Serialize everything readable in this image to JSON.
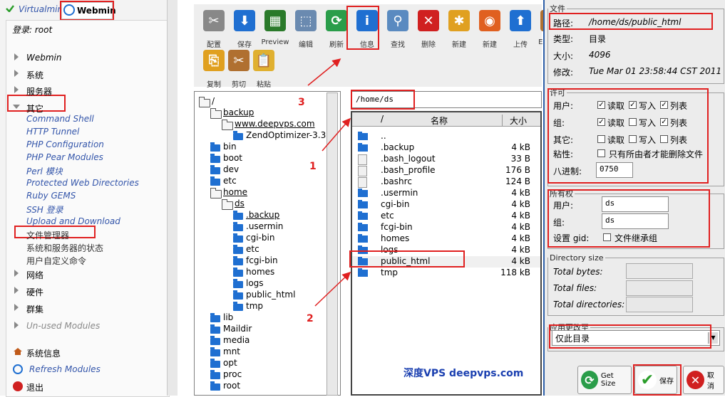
{
  "left": {
    "brand_virtualmin": "Virtualmin",
    "brand_webmin": "Webmin",
    "login_text": "登录: root",
    "nav": [
      {
        "label": "Webmin"
      },
      {
        "label": "系统"
      },
      {
        "label": "服务器"
      },
      {
        "label": "其它"
      }
    ],
    "other_items": [
      {
        "label": "Command Shell"
      },
      {
        "label": "HTTP Tunnel"
      },
      {
        "label": "PHP Configuration"
      },
      {
        "label": "PHP Pear Modules"
      },
      {
        "label": "Perl 模块"
      },
      {
        "label": "Protected Web Directories"
      },
      {
        "label": "Ruby GEMS"
      },
      {
        "label": "SSH 登录"
      },
      {
        "label": "Upload and Download"
      },
      {
        "label": "文件管理器"
      },
      {
        "label": "系统和服务器的状态"
      },
      {
        "label": "用户自定义命令"
      }
    ],
    "nav2": [
      {
        "label": "网络"
      },
      {
        "label": "硬件"
      },
      {
        "label": "群集"
      },
      {
        "label": "Un-used Modules"
      }
    ],
    "footer": [
      {
        "label": "系统信息"
      },
      {
        "label": "Refresh Modules"
      },
      {
        "label": "退出"
      }
    ]
  },
  "toolbar": {
    "row1": [
      {
        "label": "配置",
        "icon": "wrench-icon"
      },
      {
        "label": "保存",
        "icon": "download-arrow-icon"
      },
      {
        "label": "Preview",
        "icon": "preview-icon"
      },
      {
        "label": "编辑",
        "icon": "edit-frame-icon"
      },
      {
        "label": "刷新",
        "icon": "refresh-icon"
      },
      {
        "label": "信息",
        "icon": "info-icon"
      },
      {
        "label": "查找",
        "icon": "magnifier-icon"
      },
      {
        "label": "删除",
        "icon": "delete-icon"
      },
      {
        "label": "新建",
        "icon": "new-file-icon"
      },
      {
        "label": "新建",
        "icon": "firefox-icon"
      },
      {
        "label": "上传",
        "icon": "upload-arrow-icon"
      },
      {
        "label": "Extract",
        "icon": "box-icon"
      }
    ],
    "row2": [
      {
        "label": "复制",
        "icon": "copy-icon"
      },
      {
        "label": "剪切",
        "icon": "scissors-icon"
      },
      {
        "label": "粘贴",
        "icon": "paste-icon"
      }
    ]
  },
  "tree": [
    {
      "label": "/",
      "depth": 0,
      "open": true
    },
    {
      "label": "backup",
      "depth": 1,
      "open": true
    },
    {
      "label": "www.deepvps.com",
      "depth": 2,
      "open": true
    },
    {
      "label": "ZendOptimizer-3.3.",
      "depth": 3,
      "open": false
    },
    {
      "label": "bin",
      "depth": 1,
      "open": false
    },
    {
      "label": "boot",
      "depth": 1,
      "open": false
    },
    {
      "label": "dev",
      "depth": 1,
      "open": false
    },
    {
      "label": "etc",
      "depth": 1,
      "open": false
    },
    {
      "label": "home",
      "depth": 1,
      "open": true
    },
    {
      "label": "ds",
      "depth": 2,
      "open": true
    },
    {
      "label": ".backup",
      "depth": 3,
      "open": false
    },
    {
      "label": ".usermin",
      "depth": 3,
      "open": false
    },
    {
      "label": "cgi-bin",
      "depth": 3,
      "open": false
    },
    {
      "label": "etc",
      "depth": 3,
      "open": false
    },
    {
      "label": "fcgi-bin",
      "depth": 3,
      "open": false
    },
    {
      "label": "homes",
      "depth": 3,
      "open": false
    },
    {
      "label": "logs",
      "depth": 3,
      "open": false
    },
    {
      "label": "public_html",
      "depth": 3,
      "open": false
    },
    {
      "label": "tmp",
      "depth": 3,
      "open": false
    },
    {
      "label": "lib",
      "depth": 1,
      "open": false
    },
    {
      "label": "Maildir",
      "depth": 1,
      "open": false
    },
    {
      "label": "media",
      "depth": 1,
      "open": false
    },
    {
      "label": "mnt",
      "depth": 1,
      "open": false
    },
    {
      "label": "opt",
      "depth": 1,
      "open": false
    },
    {
      "label": "proc",
      "depth": 1,
      "open": false
    },
    {
      "label": "root",
      "depth": 1,
      "open": false
    }
  ],
  "path": "/home/ds",
  "list": {
    "col_sort": "/",
    "col_name": "名称",
    "col_size": "大小",
    "rows": [
      {
        "name": "..",
        "size": "",
        "kind": "folder"
      },
      {
        "name": ".backup",
        "size": "4 kB",
        "kind": "folder"
      },
      {
        "name": ".bash_logout",
        "size": "33 B",
        "kind": "file"
      },
      {
        "name": ".bash_profile",
        "size": "176 B",
        "kind": "file"
      },
      {
        "name": ".bashrc",
        "size": "124 B",
        "kind": "file"
      },
      {
        "name": ".usermin",
        "size": "4 kB",
        "kind": "folder"
      },
      {
        "name": "cgi-bin",
        "size": "4 kB",
        "kind": "folder"
      },
      {
        "name": "etc",
        "size": "4 kB",
        "kind": "folder"
      },
      {
        "name": "fcgi-bin",
        "size": "4 kB",
        "kind": "folder"
      },
      {
        "name": "homes",
        "size": "4 kB",
        "kind": "folder"
      },
      {
        "name": "logs",
        "size": "4 kB",
        "kind": "folder"
      },
      {
        "name": "public_html",
        "size": "4 kB",
        "kind": "folder"
      },
      {
        "name": "tmp",
        "size": "118 kB",
        "kind": "folder"
      }
    ]
  },
  "info": {
    "legend_file": "文件",
    "path_label": "路径:",
    "path_value": "/home/ds/public_html",
    "type_label": "类型:",
    "type_value": "目录",
    "size_label": "大小:",
    "size_value": "4096",
    "mtime_label": "修改:",
    "mtime_value": "Tue Mar 01 23:58:44 CST 2011",
    "legend_perm": "许可",
    "perm_rows": [
      {
        "label": "用户:",
        "read": "读取",
        "write": "写入",
        "list": "列表",
        "r": true,
        "w": true,
        "x": true
      },
      {
        "label": "组:",
        "read": "读取",
        "write": "写入",
        "list": "列表",
        "r": true,
        "w": false,
        "x": true
      },
      {
        "label": "其它:",
        "read": "读取",
        "write": "写入",
        "list": "列表",
        "r": false,
        "w": false,
        "x": false
      }
    ],
    "sticky_label": "粘性:",
    "sticky_text": "只有所由者才能删除文件",
    "octal_label": "八进制:",
    "octal_value": "0750",
    "legend_owner": "所有权",
    "owner_user_label": "用户:",
    "owner_user_value": "ds",
    "owner_group_label": "组:",
    "owner_group_value": "ds",
    "setgid_label": "设置 gid:",
    "setgid_text": "文件继承组",
    "legend_dirsize": "Directory size",
    "total_bytes": "Total bytes:",
    "total_files": "Total files:",
    "total_dirs": "Total directories:",
    "legend_apply": "应用更改至",
    "apply_value": "仅此目录",
    "btn_getsize": "Get Size",
    "btn_save": "保存",
    "btn_cancel": "取消"
  },
  "annotations": [
    "1",
    "2",
    "3"
  ],
  "watermark": "深度VPS deepvps.com",
  "colors": {
    "highlight": "#e02020",
    "accent": "#2d5fa8",
    "folder": "#1f6fd1",
    "link": "#3355aa"
  }
}
